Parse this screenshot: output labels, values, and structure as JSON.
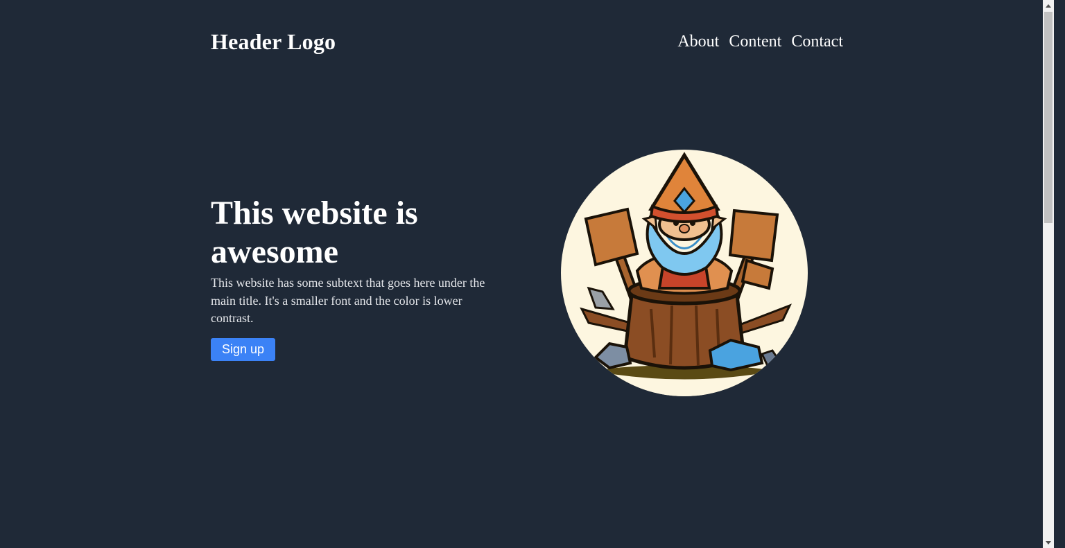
{
  "header": {
    "logo": "Header Logo",
    "nav": [
      {
        "label": "About"
      },
      {
        "label": "Content"
      },
      {
        "label": "Contact"
      }
    ]
  },
  "hero": {
    "title": "This website is awesome",
    "subtext": "This website has some subtext that goes here under the main title. It's a smaller font and the color is lower contrast.",
    "button_label": "Sign up",
    "image_icon": "gnome-on-stump-illustration"
  },
  "colors": {
    "background": "#1f2937",
    "accent": "#3b82f6",
    "text": "#ffffff",
    "subtext": "#e5e7eb"
  }
}
